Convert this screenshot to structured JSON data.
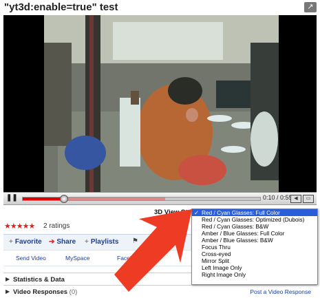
{
  "title": "\"yt3d:enable=true\" test",
  "player": {
    "time_current": "0:10",
    "time_total": "0:55",
    "progress": 0.17,
    "loaded": 0.6
  },
  "view_style": {
    "label": "3D View Style",
    "options": [
      {
        "label": "Red / Cyan Glasses: Full Color",
        "selected": true
      },
      {
        "label": "Red / Cyan Glasses: Optimized (Dubois)",
        "selected": false
      },
      {
        "label": "Red / Cyan Glasses: B&W",
        "selected": false
      },
      {
        "label": "Amber / Blue Glasses: Full Color",
        "selected": false
      },
      {
        "label": "Amber / Blue Glasses: B&W",
        "selected": false
      },
      {
        "label": "Focus Thru",
        "selected": false
      },
      {
        "label": "Cross-eyed",
        "selected": false
      },
      {
        "label": "Mirror Split",
        "selected": false
      },
      {
        "label": "Left Image Only",
        "selected": false
      },
      {
        "label": "Right Image Only",
        "selected": false
      }
    ]
  },
  "rating": {
    "stars": 5,
    "count_text": "2 ratings"
  },
  "actions": {
    "favorite": "Favorite",
    "share": "Share",
    "playlists": "Playlists"
  },
  "share_links": {
    "send_video": "Send Video",
    "myspace": "MySpace",
    "facebook": "Facebook"
  },
  "sections": {
    "statistics": "Statistics & Data",
    "video_responses": "Video Responses",
    "video_responses_count": "(0)",
    "post_response": "Post a Video Response"
  },
  "colors": {
    "accent_red": "#d22222",
    "link_blue": "#1a3e9c",
    "selection_blue": "#2a5ed8",
    "arrow_red": "#ee3b24"
  }
}
